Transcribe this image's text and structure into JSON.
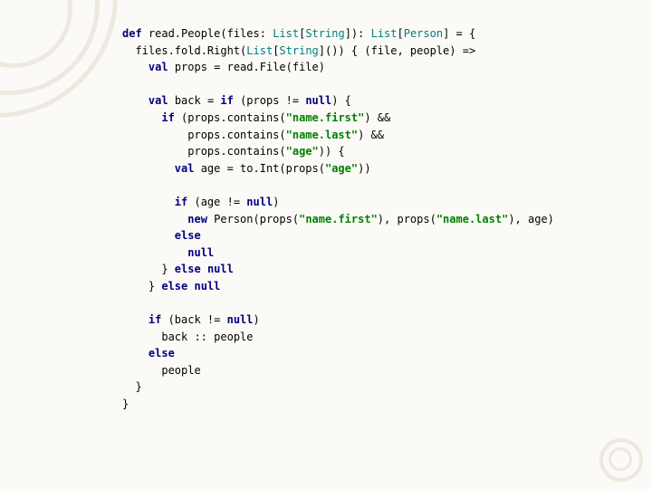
{
  "code": {
    "l01_kw_def": "def",
    "l01_a": " read.People(files: ",
    "l01_ty1": "List",
    "l01_b": "[",
    "l01_ty2": "String",
    "l01_c": "]): ",
    "l01_ty3": "List",
    "l01_d": "[",
    "l01_ty4": "Person",
    "l01_e": "] = {",
    "l02_a": "  files.fold.Right(",
    "l02_ty1": "List",
    "l02_b": "[",
    "l02_ty2": "String",
    "l02_c": "]()) { (file, people) =>",
    "l03_ind": "    ",
    "l03_kw_val": "val",
    "l03_a": " props = read.File(file)",
    "l04": "",
    "l05_ind": "    ",
    "l05_kw_val": "val",
    "l05_a": " back = ",
    "l05_kw_if": "if",
    "l05_b": " (props != ",
    "l05_kw_null": "null",
    "l05_c": ") {",
    "l06_ind": "      ",
    "l06_kw_if": "if",
    "l06_a": " (props.contains(",
    "l06_str": "\"name.first\"",
    "l06_b": ") &&",
    "l07_a": "          props.contains(",
    "l07_str": "\"name.last\"",
    "l07_b": ") &&",
    "l08_a": "          props.contains(",
    "l08_str": "\"age\"",
    "l08_b": ")) {",
    "l09_ind": "        ",
    "l09_kw_val": "val",
    "l09_a": " age = to.Int(props(",
    "l09_str": "\"age\"",
    "l09_b": "))",
    "l10": "",
    "l11_ind": "        ",
    "l11_kw_if": "if",
    "l11_a": " (age != ",
    "l11_kw_null": "null",
    "l11_b": ")",
    "l12_ind": "          ",
    "l12_kw_new": "new",
    "l12_a": " Person(props(",
    "l12_str1": "\"name.first\"",
    "l12_b": "), props(",
    "l12_str2": "\"name.last\"",
    "l12_c": "), age)",
    "l13_ind": "        ",
    "l13_kw_else": "else",
    "l14_ind": "          ",
    "l14_kw_null": "null",
    "l15_a": "      } ",
    "l15_kw_else": "else",
    "l15_b": " ",
    "l15_kw_null": "null",
    "l16_a": "    } ",
    "l16_kw_else": "else",
    "l16_b": " ",
    "l16_kw_null": "null",
    "l17": "",
    "l18_ind": "    ",
    "l18_kw_if": "if",
    "l18_a": " (back != ",
    "l18_kw_null": "null",
    "l18_b": ")",
    "l19": "      back :: people",
    "l20_ind": "    ",
    "l20_kw_else": "else",
    "l21": "      people",
    "l22": "  }",
    "l23": "}"
  }
}
